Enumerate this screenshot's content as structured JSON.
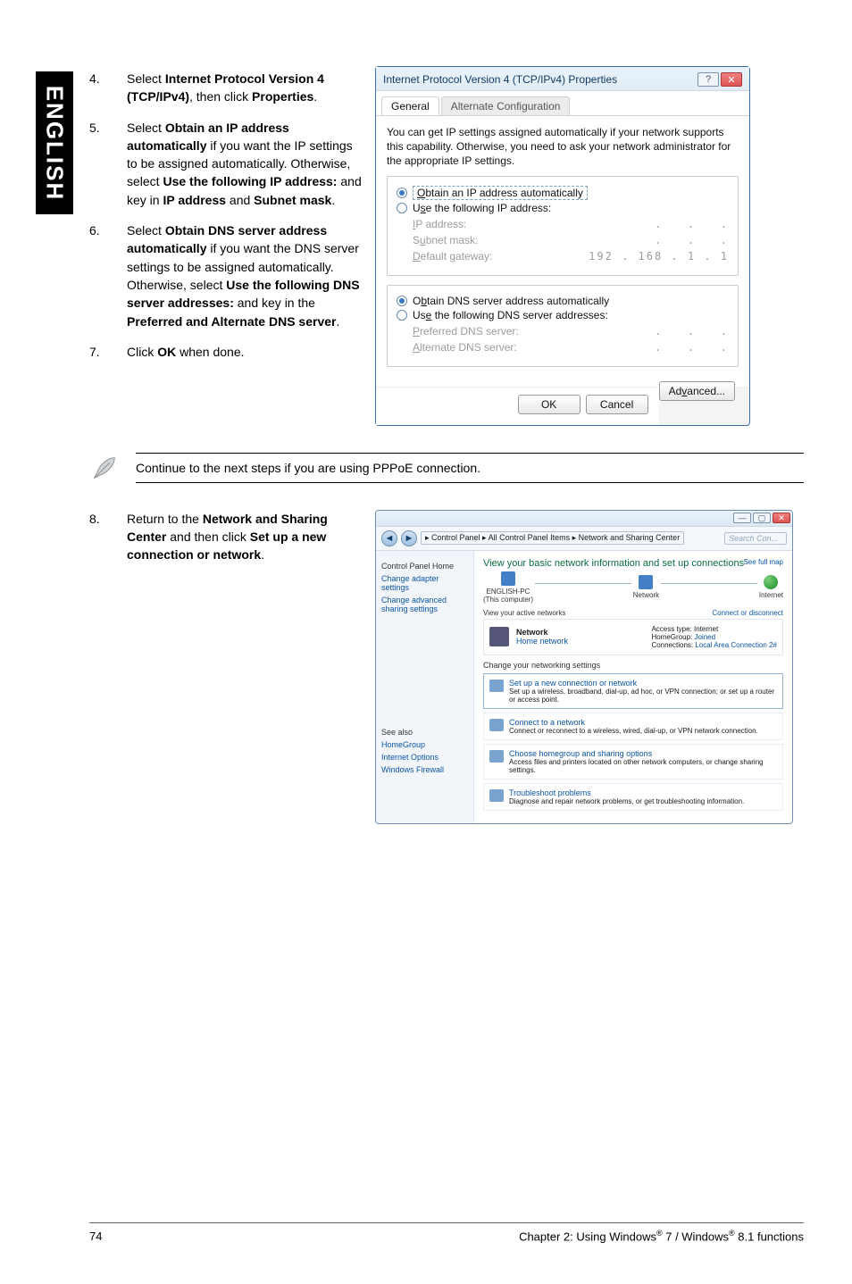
{
  "sidetab": "ENGLISH",
  "steps_first": [
    {
      "num": "4.",
      "html": "Select <b>Internet Protocol Version 4 (TCP/IPv4)</b>, then click <b>Properties</b>."
    },
    {
      "num": "5.",
      "html": "Select <b>Obtain an IP address automatically</b> if you want the IP settings to be assigned automatically. Otherwise, select <b>Use the following IP address:</b> and key in <b>IP address</b> and <b>Subnet mask</b>."
    },
    {
      "num": "6.",
      "html": "Select <b>Obtain DNS server address automatically</b> if you want the DNS server settings to be assigned automatically. Otherwise, select <b>Use the following DNS server addresses:</b> and key in the <b>Preferred and Alternate DNS server</b>."
    },
    {
      "num": "7.",
      "html": "Click <b>OK</b> when done."
    }
  ],
  "note": "Continue to the next steps if you are using PPPoE connection.",
  "steps_second": [
    {
      "num": "8.",
      "html": "Return to the <b>Network and Sharing Center</b> and then click <b>Set up a new connection or network</b>."
    }
  ],
  "props_dialog": {
    "title": "Internet Protocol Version 4 (TCP/IPv4) Properties",
    "tab_general": "General",
    "tab_alt": "Alternate Configuration",
    "desc": "You can get IP settings assigned automatically if your network supports this capability. Otherwise, you need to ask your network administrator for the appropriate IP settings.",
    "r_ip_auto": "Obtain an IP address automatically",
    "r_ip_manual": "Use the following IP address:",
    "lab_ip": "IP address:",
    "lab_subnet": "Subnet mask:",
    "lab_gateway": "Default gateway:",
    "val_gateway": "192 . 168 .  1  .  1",
    "r_dns_auto": "Obtain DNS server address automatically",
    "r_dns_manual": "Use the following DNS server addresses:",
    "lab_pref": "Preferred DNS server:",
    "lab_alt": "Alternate DNS server:",
    "btn_advanced": "Advanced...",
    "btn_ok": "OK",
    "btn_cancel": "Cancel"
  },
  "nsc": {
    "breadcrumb": "▸ Control Panel ▸ All Control Panel Items ▸ Network and Sharing Center",
    "search_placeholder": "Search Con...",
    "side_home": "Control Panel Home",
    "side_adapter": "Change adapter settings",
    "side_advshare": "Change advanced sharing settings",
    "side_seealso": "See also",
    "side_hg": "HomeGroup",
    "side_io": "Internet Options",
    "side_wf": "Windows Firewall",
    "hdr": "View your basic network information and set up connections",
    "fullmap": "See full map",
    "node_pc": "ENGLISH-PC",
    "node_pc_sub": "(This computer)",
    "node_net": "Network",
    "node_inet": "Internet",
    "view_active": "View your active networks",
    "conn_disc": "Connect or disconnect",
    "active_name": "Network",
    "active_sub": "Home network",
    "status_access_l": "Access type:",
    "status_access_v": "Internet",
    "status_hg_l": "HomeGroup:",
    "status_hg_v": "Joined",
    "status_conn_l": "Connections:",
    "status_conn_v": "Local Area Connection 2#",
    "change_hdr": "Change your networking settings",
    "opt1_t": "Set up a new connection or network",
    "opt1_d": "Set up a wireless, broadband, dial-up, ad hoc, or VPN connection; or set up a router or access point.",
    "opt2_t": "Connect to a network",
    "opt2_d": "Connect or reconnect to a wireless, wired, dial-up, or VPN network connection.",
    "opt3_t": "Choose homegroup and sharing options",
    "opt3_d": "Access files and printers located on other network computers, or change sharing settings.",
    "opt4_t": "Troubleshoot problems",
    "opt4_d": "Diagnose and repair network problems, or get troubleshooting information."
  },
  "footer": {
    "page": "74",
    "chapter_pre": "Chapter 2: Using Windows",
    "chapter_mid": " 7 / Windows",
    "chapter_end": " 8.1 functions",
    "reg": "®"
  }
}
